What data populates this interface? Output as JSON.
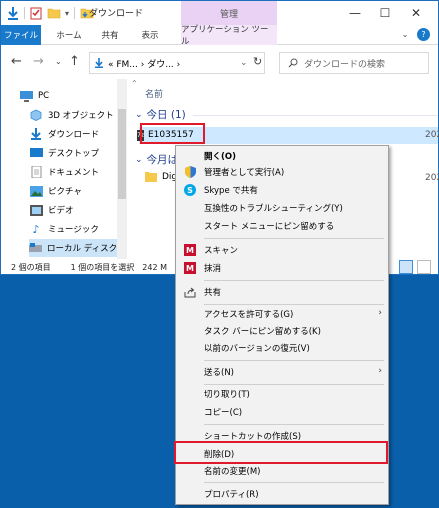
{
  "titlebar": {
    "title": "ダウンロード",
    "contextual_tab": "管理",
    "minimize": "—",
    "maximize": "☐",
    "close": "✕"
  },
  "ribbon": {
    "tabs": [
      "ファイル",
      "ホーム",
      "共有",
      "表示",
      "アプリケーション ツール"
    ],
    "chevron": "⌄",
    "help": "?"
  },
  "address": {
    "path": "« FM... › ダウ... ›",
    "refresh": "↻",
    "search_placeholder": "ダウンロードの検索"
  },
  "nav": {
    "items": [
      "PC",
      "3D オブジェクト",
      "ダウンロード",
      "デスクトップ",
      "ドキュメント",
      "ピクチャ",
      "ビデオ",
      "ミュージック",
      "ローカル ディスク (C"
    ]
  },
  "content": {
    "column_name": "名前",
    "group_today": "今日 (1)",
    "group_month": "今月は",
    "file_name": "E1035157",
    "file_date": "202",
    "folder_name": "Dig",
    "folder_date": "202"
  },
  "status": {
    "count": "2 個の項目",
    "selected": "1 個の項目を選択",
    "size": "242 M"
  },
  "menu": {
    "open": "開く(O)",
    "run_as_admin": "管理者として実行(A)",
    "skype_share": "Skype で共有",
    "compat": "互換性のトラブルシューティング(Y)",
    "pin_start": "スタート メニューにピン留めする",
    "scan": "スキャン",
    "shred": "抹消",
    "share": "共有",
    "give_access": "アクセスを許可する(G)",
    "pin_taskbar": "タスク バーにピン留めする(K)",
    "restore": "以前のバージョンの復元(V)",
    "send_to": "送る(N)",
    "cut": "切り取り(T)",
    "copy": "コピー(C)",
    "create_shortcut": "ショートカットの作成(S)",
    "delete": "削除(D)",
    "rename": "名前の変更(M)",
    "properties": "プロパティ(R)"
  },
  "colors": {
    "accent": "#1979ca",
    "highlight": "#e0192c",
    "desktop": "#0a5fab"
  }
}
